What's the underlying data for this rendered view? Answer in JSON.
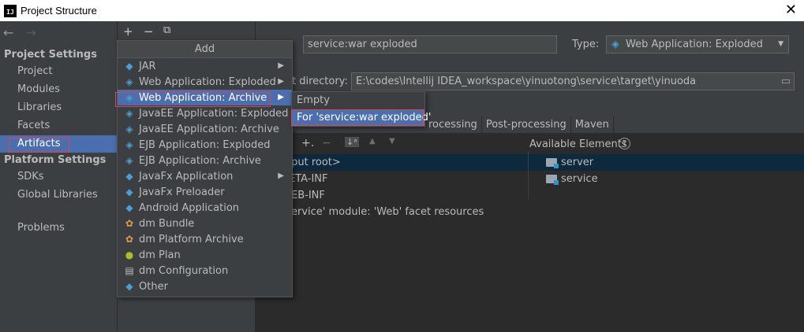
{
  "window": {
    "title": "Project Structure",
    "icon_label": "IJ",
    "close_glyph": "✕"
  },
  "nav": {
    "back": "←",
    "forward": "→"
  },
  "sidebar": {
    "project_settings_header": "Project Settings",
    "project_items": [
      "Project",
      "Modules",
      "Libraries",
      "Facets",
      "Artifacts"
    ],
    "selected": "Artifacts",
    "platform_settings_header": "Platform Settings",
    "platform_items": [
      "SDKs",
      "Global Libraries"
    ],
    "problems": "Problems"
  },
  "toolbar": {
    "add": "+",
    "remove": "−",
    "copy": "⧉"
  },
  "artifact": {
    "name_value": "service:war exploded",
    "type_label": "Type:",
    "type_value": "Web Application: Exploded",
    "output_label": "t directory:",
    "output_value": "E:\\codes\\Intellij IDEA_workspace\\yinuotong\\service\\target\\yinuoda"
  },
  "tabs": [
    "rocessing",
    "Post-processing",
    "Maven"
  ],
  "layout": {
    "available_label": "Available Elements",
    "help_icon": "?",
    "tree_left": [
      "tput root>",
      "ETA-INF",
      "EB-INF",
      "ervice' module: 'Web' facet resources"
    ],
    "tree_right": [
      "server",
      "service"
    ]
  },
  "add_menu": {
    "header": "Add",
    "items": [
      {
        "label": "JAR",
        "icon": "◆",
        "arrow": "▶"
      },
      {
        "label": "Web Application: Exploded",
        "icon": "◈",
        "arrow": "▶"
      },
      {
        "label": "Web Application: Archive",
        "icon": "◈",
        "arrow": "▶"
      },
      {
        "label": "JavaEE Application: Exploded",
        "icon": "◈",
        "arrow": ""
      },
      {
        "label": "JavaEE Application: Archive",
        "icon": "◈",
        "arrow": ""
      },
      {
        "label": "EJB Application: Exploded",
        "icon": "◈",
        "arrow": ""
      },
      {
        "label": "EJB Application: Archive",
        "icon": "◈",
        "arrow": ""
      },
      {
        "label": "JavaFx Application",
        "icon": "◆",
        "arrow": "▶"
      },
      {
        "label": "JavaFx Preloader",
        "icon": "◆",
        "arrow": ""
      },
      {
        "label": "Android Application",
        "icon": "◆",
        "arrow": ""
      },
      {
        "label": "dm Bundle",
        "icon": "✿",
        "arrow": ""
      },
      {
        "label": "dm Platform Archive",
        "icon": "✿",
        "arrow": ""
      },
      {
        "label": "dm Plan",
        "icon": "●",
        "arrow": ""
      },
      {
        "label": "dm Configuration",
        "icon": "▤",
        "arrow": ""
      },
      {
        "label": "Other",
        "icon": "◆",
        "arrow": ""
      }
    ]
  },
  "submenu": {
    "items": [
      "Empty",
      "For 'service:war exploded'"
    ]
  }
}
